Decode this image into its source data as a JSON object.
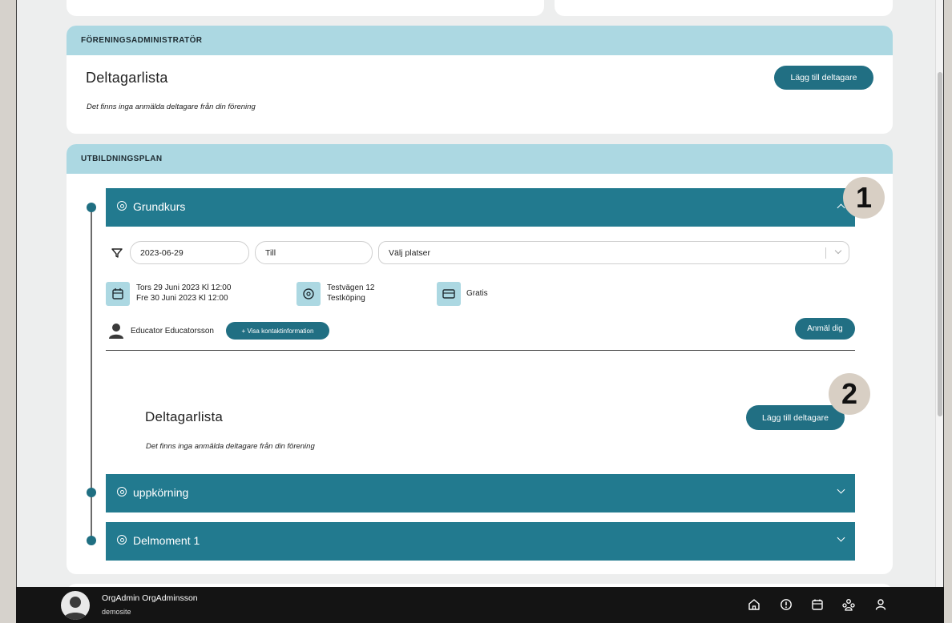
{
  "admin_section": {
    "header": "FÖRENINGSADMINISTRATÖR",
    "title": "Deltagarlista",
    "add_button": "Lägg till deltagare",
    "empty_note": "Det finns inga anmälda deltagare från din förening"
  },
  "plan_section": {
    "header": "UTBILDNINGSPLAN",
    "items": [
      {
        "label": "Grundkurs",
        "expanded": true
      },
      {
        "label": "uppkörning",
        "expanded": false
      },
      {
        "label": "Delmoment 1",
        "expanded": false
      }
    ]
  },
  "filters": {
    "date_from": "2023-06-29",
    "date_to_placeholder": "Till",
    "location_placeholder": "Välj platser"
  },
  "details": {
    "date_line1": "Tors 29 Juni 2023 Kl 12:00",
    "date_line2": "Fre 30 Juni 2023 Kl 12:00",
    "address_line1": "Testvägen 12",
    "address_line2": "Testköping",
    "price": "Gratis"
  },
  "educator": {
    "name": "Educator Educatorsson",
    "contact_button": "+ Visa kontaktinformation"
  },
  "signup_button": "Anmäl dig",
  "course_participants": {
    "title": "Deltagarlista",
    "add_button": "Lägg till deltagare",
    "empty_note": "Det finns inga anmälda deltagare från din förening"
  },
  "annotations": {
    "badge1": "1",
    "badge2": "2"
  },
  "footer": {
    "user_name": "OrgAdmin OrgAdminsson",
    "site": "demosite",
    "nav_icons": [
      "home-icon",
      "info-icon",
      "calendar-icon",
      "organization-icon",
      "user-icon"
    ]
  },
  "colors": {
    "header_bg": "#acd8e2",
    "accent": "#227a8f",
    "button": "#216f83",
    "footer_bg": "#141414"
  }
}
